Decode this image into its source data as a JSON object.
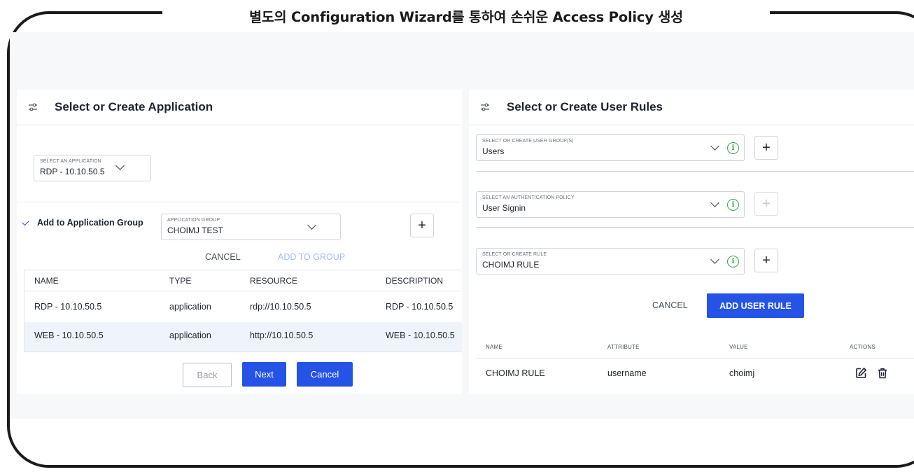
{
  "banner": {
    "title": "별도의 Configuration Wizard를 통하여 손쉬운 Access Policy 생성"
  },
  "left_panel": {
    "title": "Select or Create Application",
    "application_select": {
      "label": "SELECT AN APPLICATION",
      "value": "RDP - 10.10.50.5"
    },
    "add_to_group": {
      "checked": true,
      "label": "Add to Application Group"
    },
    "group_select": {
      "label": "APPLICATION GROUP",
      "value": "CHOIMJ TEST"
    },
    "add_button": "+",
    "cancel_label": "CANCEL",
    "add_to_group_label": "ADD TO GROUP",
    "table": {
      "columns": [
        "NAME",
        "TYPE",
        "RESOURCE",
        "DESCRIPTION"
      ],
      "rows": [
        [
          "RDP - 10.10.50.5",
          "application",
          "rdp://10.10.50.5",
          "RDP - 10.10.50.5"
        ],
        [
          "WEB - 10.10.50.5",
          "application",
          "http://10.10.50.5",
          "WEB - 10.10.50.5"
        ]
      ],
      "selected_row": 1
    },
    "footer": {
      "back": "Back",
      "next": "Next",
      "cancel": "Cancel"
    }
  },
  "right_panel": {
    "title": "Select or Create User Rules",
    "user_group_select": {
      "label": "SELECT OR CREATE USER GROUP(S)",
      "value": "Users"
    },
    "auth_policy_select": {
      "label": "SELECT AN AUTHENTICATION POLICY",
      "value": "User Signin"
    },
    "rule_select": {
      "label": "SELECT OR CREATE RULE",
      "value": "CHOIMJ RULE"
    },
    "add_button": "+",
    "info_glyph": "i",
    "cancel_label": "CANCEL",
    "add_user_rule_label": "ADD USER RULE",
    "rules_table": {
      "columns": [
        "NAME",
        "ATTRIBUTE",
        "VALUE",
        "ACTIONS"
      ],
      "rows": [
        [
          "CHOIMJ RULE",
          "username",
          "choimj"
        ]
      ]
    }
  },
  "colors": {
    "accent": "#2553e6",
    "info_green": "#3aa54a",
    "selected_row": "#eef3fc",
    "frame": "#1b1b1b"
  },
  "icons": [
    "filter-sliders-icon",
    "chevron-down-icon",
    "check-icon",
    "info-icon",
    "plus-icon",
    "edit-icon",
    "trash-icon"
  ]
}
